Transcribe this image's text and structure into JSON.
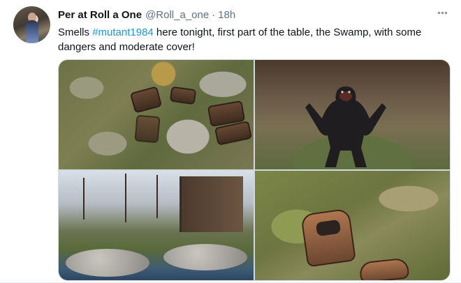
{
  "tweet": {
    "display_name": "Per at Roll a One",
    "handle": "@Roll_a_one",
    "separator": "·",
    "time": "18h",
    "text_before": "Smells ",
    "hashtag": "#mutant1984",
    "text_after": " here tonight, first part of the table, the Swamp, with some dangers and moderate cover!"
  },
  "icons": {
    "avatar": "profile-photo",
    "more": "more-options-icon"
  },
  "colors": {
    "link": "#1b95e0",
    "secondary_text": "#5b7083",
    "primary_text": "#0f1419",
    "border": "#cfd9de"
  }
}
